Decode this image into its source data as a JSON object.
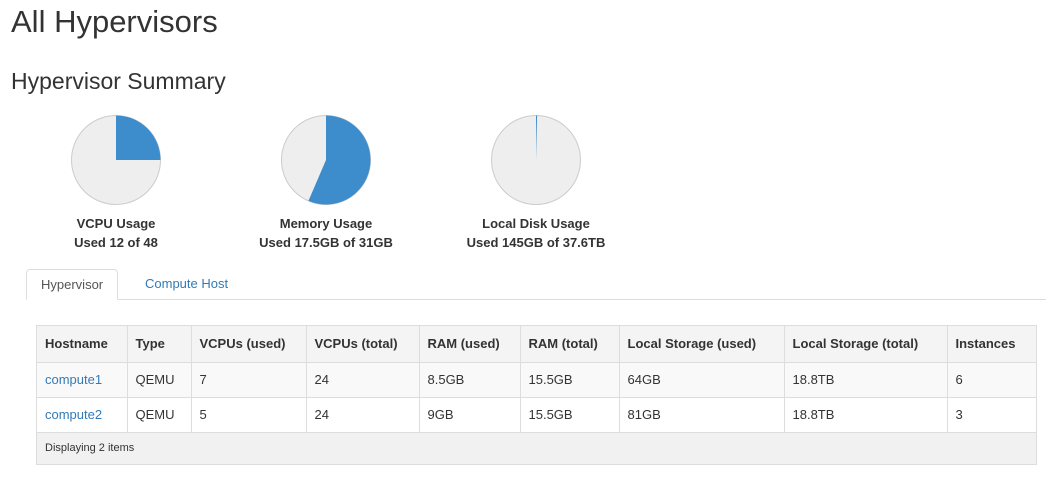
{
  "page": {
    "title": "All Hypervisors",
    "summary_title": "Hypervisor Summary"
  },
  "summary": {
    "charts": [
      {
        "label": "VCPU Usage",
        "detail": "Used 12 of 48",
        "used": 12,
        "total": 48
      },
      {
        "label": "Memory Usage",
        "detail": "Used 17.5GB of 31GB",
        "used": 17.5,
        "total": 31
      },
      {
        "label": "Local Disk Usage",
        "detail": "Used 145GB of 37.6TB",
        "used": 0.145,
        "total": 37.6
      }
    ],
    "colors": {
      "used": "#3d8ccc",
      "free": "#eeeeee",
      "outline": "#cccccc"
    }
  },
  "tabs": [
    "Hypervisor",
    "Compute Host"
  ],
  "table": {
    "columns": [
      "Hostname",
      "Type",
      "VCPUs (used)",
      "VCPUs (total)",
      "RAM (used)",
      "RAM (total)",
      "Local Storage (used)",
      "Local Storage (total)",
      "Instances"
    ],
    "rows": [
      {
        "hostname": "compute1",
        "type": "QEMU",
        "vcpus_used": "7",
        "vcpus_total": "24",
        "ram_used": "8.5GB",
        "ram_total": "15.5GB",
        "storage_used": "64GB",
        "storage_total": "18.8TB",
        "instances": "6"
      },
      {
        "hostname": "compute2",
        "type": "QEMU",
        "vcpus_used": "5",
        "vcpus_total": "24",
        "ram_used": "9GB",
        "ram_total": "15.5GB",
        "storage_used": "81GB",
        "storage_total": "18.8TB",
        "instances": "3"
      }
    ],
    "footer": "Displaying 2 items"
  }
}
